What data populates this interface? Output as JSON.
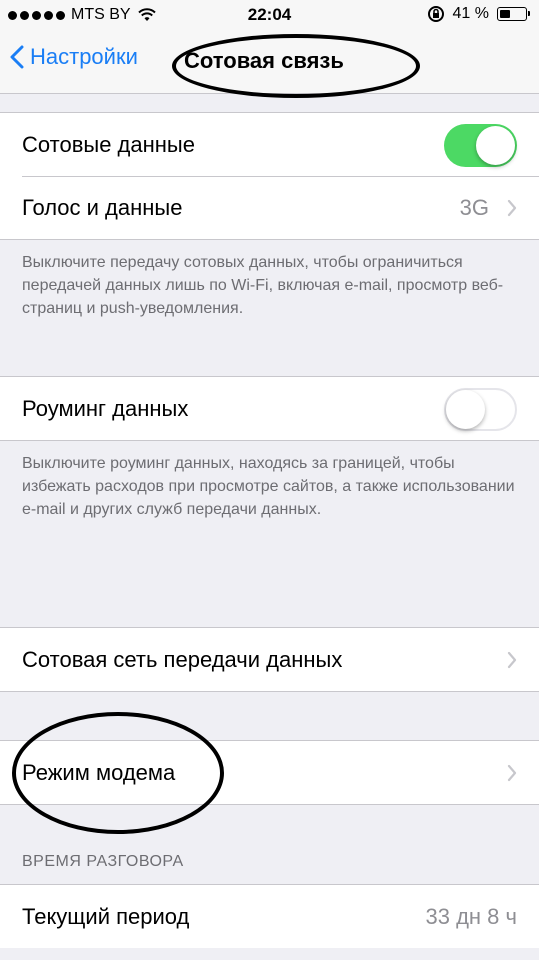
{
  "status_bar": {
    "carrier": "MTS BY",
    "time": "22:04",
    "battery_percent_label": "41 %",
    "battery_level": 0.41,
    "signal_icon": "signal-dots-icon",
    "wifi_icon": "wifi-icon",
    "rotation_lock_icon": "rotation-lock-icon"
  },
  "nav": {
    "back_label": "Настройки",
    "title": "Сотовая связь"
  },
  "cellular_group": {
    "cellular_data": {
      "label": "Сотовые данные",
      "enabled": true
    },
    "voice_data": {
      "label": "Голос и данные",
      "value": "3G"
    }
  },
  "cellular_note": "Выключите передачу сотовых данных, чтобы ограничиться передачей данных лишь по Wi-Fi, включая e-mail, просмотр веб-страниц и push-уведомления.",
  "roaming": {
    "label": "Роуминг данных",
    "enabled": false
  },
  "roaming_note": "Выключите роуминг данных, находясь за границей, чтобы избежать расходов при просмотре сайтов, а также использовании e-mail и других служб передачи данных.",
  "cellular_network": {
    "label": "Сотовая сеть передачи данных"
  },
  "hotspot": {
    "label": "Режим модема"
  },
  "call_time": {
    "header": "ВРЕМЯ РАЗГОВОРА",
    "current_period": {
      "label": "Текущий период",
      "value": "33 дн 8 ч"
    }
  },
  "colors": {
    "accent": "#1a7ef5",
    "toggle_on": "#4cd964",
    "background": "#efeff4"
  }
}
